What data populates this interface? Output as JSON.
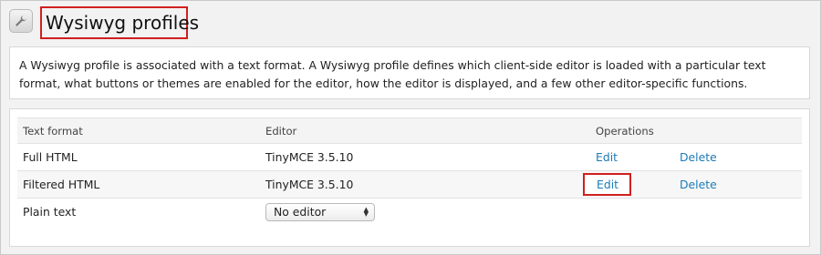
{
  "page": {
    "title": "Wysiwyg profiles",
    "description": "A Wysiwyg profile is associated with a text format. A Wysiwyg profile defines which client-side editor is loaded with a particular text format, what buttons or themes are enabled for the editor, how the editor is displayed, and a few other editor-specific functions."
  },
  "table": {
    "headers": {
      "text_format": "Text format",
      "editor": "Editor",
      "operations": "Operations"
    },
    "rows": [
      {
        "format": "Full HTML",
        "editor": "TinyMCE 3.5.10",
        "edit": "Edit",
        "delete": "Delete"
      },
      {
        "format": "Filtered HTML",
        "editor": "TinyMCE 3.5.10",
        "edit": "Edit",
        "delete": "Delete"
      },
      {
        "format": "Plain text",
        "editor_select": "No editor"
      }
    ]
  },
  "colors": {
    "link": "#1a7bb8",
    "highlight": "#d11f1f"
  },
  "icons": {
    "header": "wrench-icon",
    "select": "select-arrows-icon"
  }
}
